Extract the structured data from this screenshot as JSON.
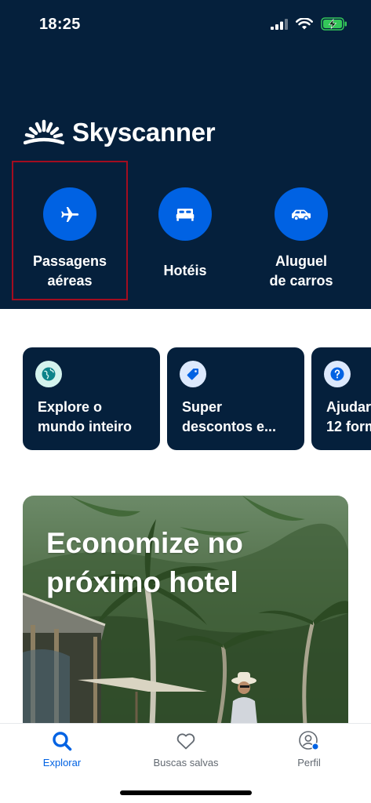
{
  "status_bar": {
    "time": "18:25"
  },
  "brand": {
    "name": "Skyscanner"
  },
  "categories": [
    {
      "label": "Passagens\naéreas",
      "icon": "plane-icon",
      "selected": true
    },
    {
      "label": "Hotéis",
      "icon": "bed-icon",
      "selected": false
    },
    {
      "label": "Aluguel\nde carros",
      "icon": "car-icon",
      "selected": false
    }
  ],
  "cards": [
    {
      "label": "Explore o\nmundo inteiro",
      "icon": "globe-icon"
    },
    {
      "label": "Super\ndescontos e...",
      "icon": "tag-icon"
    },
    {
      "label": "Ajudar\n12 form",
      "icon": "question-icon"
    }
  ],
  "promo": {
    "title": "Economize no\npróximo hotel"
  },
  "tabs": [
    {
      "label": "Explorar",
      "icon": "search-icon",
      "active": true
    },
    {
      "label": "Buscas salvas",
      "icon": "heart-icon",
      "active": false
    },
    {
      "label": "Perfil",
      "icon": "profile-icon",
      "active": false
    }
  ],
  "colors": {
    "header_bg": "#05203c",
    "accent": "#0062e3",
    "selection_border": "#a30d20",
    "card_bg": "#05203c"
  }
}
